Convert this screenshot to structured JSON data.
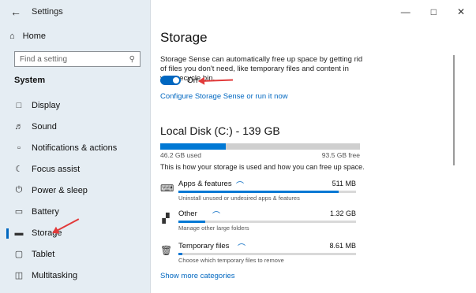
{
  "app": {
    "title": "Settings"
  },
  "sidebar": {
    "home_label": "Home",
    "search_placeholder": "Find a setting",
    "section_title": "System",
    "items": [
      {
        "label": "Display",
        "icon": "display-icon"
      },
      {
        "label": "Sound",
        "icon": "sound-icon"
      },
      {
        "label": "Notifications & actions",
        "icon": "notifications-icon"
      },
      {
        "label": "Focus assist",
        "icon": "focus-assist-icon"
      },
      {
        "label": "Power & sleep",
        "icon": "power-icon"
      },
      {
        "label": "Battery",
        "icon": "battery-icon"
      },
      {
        "label": "Storage",
        "icon": "storage-icon",
        "selected": true
      },
      {
        "label": "Tablet",
        "icon": "tablet-icon"
      },
      {
        "label": "Multitasking",
        "icon": "multitasking-icon"
      }
    ]
  },
  "main": {
    "title": "Storage",
    "description": "Storage Sense can automatically free up space by getting rid of files you don't need, like temporary files and content in your recycle bin.",
    "toggle": {
      "label": "On",
      "state": "on"
    },
    "configure_link": "Configure Storage Sense or run it now",
    "disk": {
      "title": "Local Disk (C:) - 139 GB",
      "used_label": "46.2 GB used",
      "free_label": "93.5 GB free",
      "used_fraction": 0.33
    },
    "how_text": "This is how your storage is used and how you can free up space.",
    "categories": [
      {
        "name": "Apps & features",
        "size": "511 MB",
        "sub": "Uninstall unused or undesired apps & features",
        "icon": "apps-icon",
        "fill": 0.9
      },
      {
        "name": "Other",
        "size": "1.32 GB",
        "sub": "Manage other large folders",
        "icon": "other-icon",
        "fill": 0.15
      },
      {
        "name": "Temporary files",
        "size": "8.61 MB",
        "sub": "Choose which temporary files to remove",
        "icon": "trash-icon",
        "fill": 0.02
      }
    ],
    "more_link": "Show more categories"
  },
  "colors": {
    "accent": "#0067c0",
    "sidebar_bg": "#e5edf3",
    "annotation": "#e23a3a"
  }
}
